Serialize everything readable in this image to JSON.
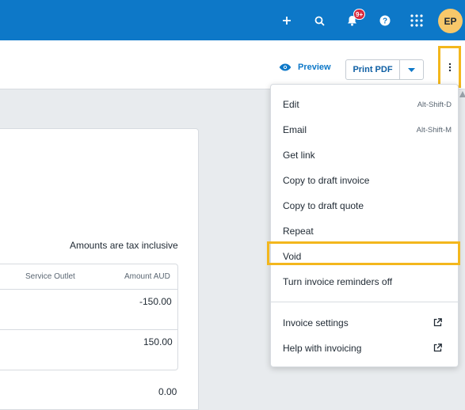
{
  "topbar": {
    "icons": [
      "plus-icon",
      "search-icon",
      "bell-icon",
      "help-icon",
      "apps-grid-icon"
    ],
    "notification_badge": "9+",
    "avatar_initials": "EP",
    "bg_color": "#0d78c8"
  },
  "toolbar": {
    "preview_label": "Preview",
    "print_pdf_label": "Print PDF"
  },
  "invoice": {
    "tax_note": "Amounts are tax inclusive",
    "columns": [
      "Service Outlet",
      "Amount AUD"
    ],
    "rows": [
      {
        "amount": "-150.00"
      },
      {
        "amount": "150.00"
      }
    ],
    "total": "0.00"
  },
  "menu": {
    "items": [
      {
        "label": "Edit",
        "shortcut": "Alt-Shift-D"
      },
      {
        "label": "Email",
        "shortcut": "Alt-Shift-M"
      },
      {
        "label": "Get link"
      },
      {
        "label": "Copy to draft invoice"
      },
      {
        "label": "Copy to draft quote"
      },
      {
        "label": "Repeat"
      },
      {
        "label": "Void"
      },
      {
        "label": "Turn invoice reminders off"
      },
      {
        "label": "Invoice settings",
        "icon": "external-link-icon"
      },
      {
        "label": "Help with invoicing",
        "icon": "external-link-icon"
      }
    ],
    "highlight_color": "#f3b71d"
  }
}
